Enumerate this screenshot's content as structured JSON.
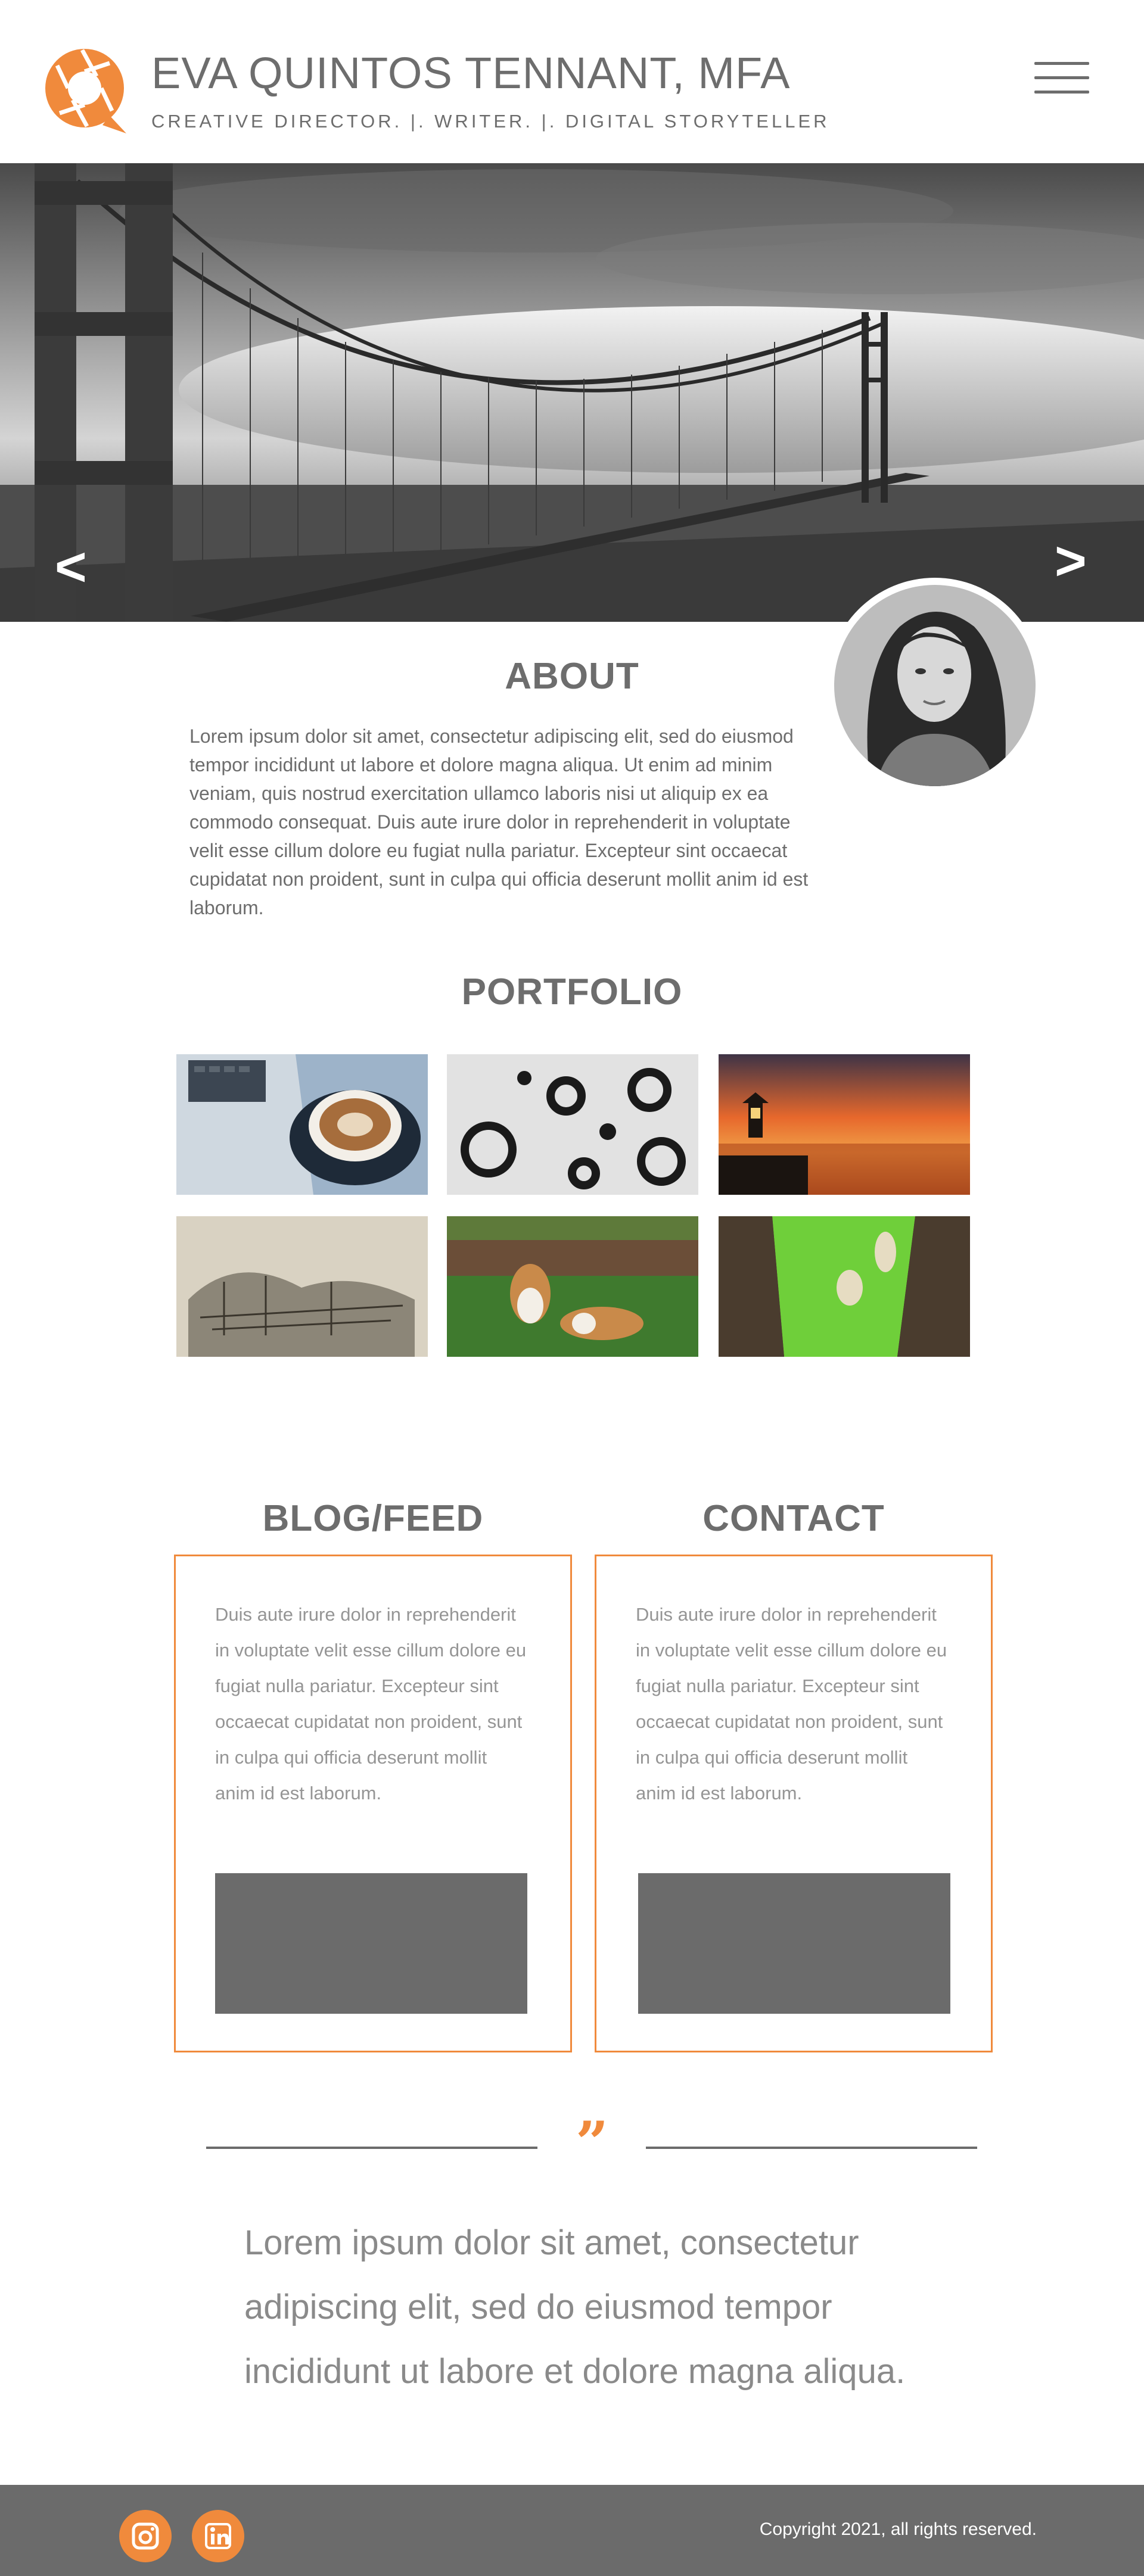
{
  "header": {
    "name": "EVA QUINTOS TENNANT, MFA",
    "tagline": "CREATIVE DIRECTOR. |. WRITER. |. DIGITAL STORYTELLER",
    "logo_icon": "camera-aperture-icon",
    "menu_icon": "hamburger-menu-icon"
  },
  "hero": {
    "prev_label": "<",
    "next_label": ">",
    "image": "golden-gate-bridge-fog-bw"
  },
  "about": {
    "title": "ABOUT",
    "text": "Lorem ipsum dolor sit amet, consectetur adipiscing elit, sed do eiusmod tempor incididunt ut labore et dolore magna aliqua. Ut enim ad minim veniam, quis nostrud exercitation ullamco laboris nisi ut aliquip ex ea commodo consequat. Duis aute irure dolor in reprehenderit in voluptate velit esse cillum dolore eu fugiat nulla pariatur. Excepteur sint occaecat cupidatat non proident, sunt in culpa qui officia deserunt mollit anim id est laborum."
  },
  "portfolio": {
    "title": "PORTFOLIO",
    "items": [
      {
        "image": "laptop-and-latte"
      },
      {
        "image": "letter-g-typography"
      },
      {
        "image": "sunset-pier-lantern"
      },
      {
        "image": "sepia-city-sketch"
      },
      {
        "image": "collies-on-grass"
      },
      {
        "image": "illustrated-dogs-path"
      }
    ]
  },
  "blog": {
    "title": "BLOG/FEED",
    "text": "Duis aute irure dolor in reprehenderit in voluptate velit esse cillum dolore eu fugiat nulla pariatur. Excepteur sint occaecat cupidatat non proident, sunt in culpa qui officia deserunt mollit anim id est laborum."
  },
  "contact": {
    "title": "CONTACT",
    "text": "Duis aute irure dolor in reprehenderit in voluptate velit esse cillum dolore eu fugiat nulla pariatur. Excepteur sint occaecat cupidatat non proident, sunt in culpa qui officia deserunt mollit anim id est laborum."
  },
  "quote": {
    "mark": "”",
    "text": "Lorem ipsum dolor sit amet, consectetur adipiscing elit, sed do eiusmod tempor incididunt ut labore et dolore magna aliqua."
  },
  "footer": {
    "copyright": "Copyright 2021, all rights reserved.",
    "social": [
      "instagram-icon",
      "linkedin-icon"
    ]
  },
  "colors": {
    "accent": "#f08a3c",
    "text": "#6d6d6d",
    "footer": "#6b6b6b"
  }
}
